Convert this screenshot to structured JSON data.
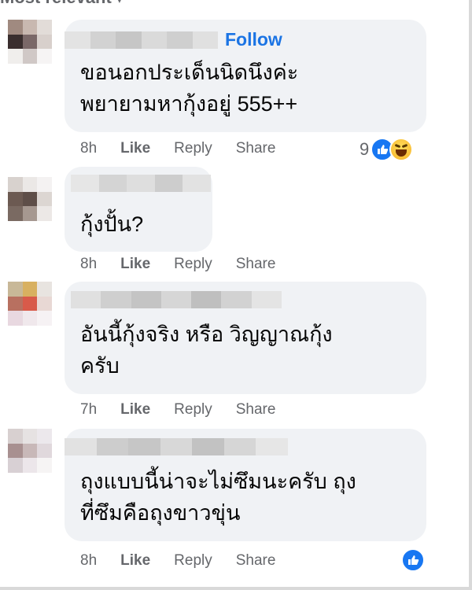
{
  "filter": {
    "label": "Most relevant"
  },
  "comments": [
    {
      "follow_label": "Follow",
      "lines": [
        "ขอนอกประเด็นนิดนึงค่ะ",
        "พยายามหากุ้งอยู่ 555++"
      ],
      "time": "8h",
      "like_label": "Like",
      "reply_label": "Reply",
      "share_label": "Share",
      "reaction_count": "9",
      "reactions": [
        "like-icon",
        "haha-icon"
      ]
    },
    {
      "lines": [
        "กุ้งปั้น?"
      ],
      "time": "8h",
      "like_label": "Like",
      "reply_label": "Reply",
      "share_label": "Share"
    },
    {
      "lines": [
        "อันนี้กุ้งจริง หรือ วิญญาณกุ้ง",
        "ครับ"
      ],
      "time": "7h",
      "like_label": "Like",
      "reply_label": "Reply",
      "share_label": "Share"
    },
    {
      "lines": [
        "ถุงแบบนี้น่าจะไม่ซึมนะครับ ถุง",
        "ที่ซึมคือถุงขาวขุ่น"
      ],
      "time": "8h",
      "like_label": "Like",
      "reply_label": "Reply",
      "share_label": "Share",
      "reactions": [
        "like-icon"
      ]
    }
  ],
  "colors": {
    "bubble": "#f0f2f5",
    "link": "#1b74e4",
    "meta": "#65676b",
    "like": "#1877f2"
  }
}
